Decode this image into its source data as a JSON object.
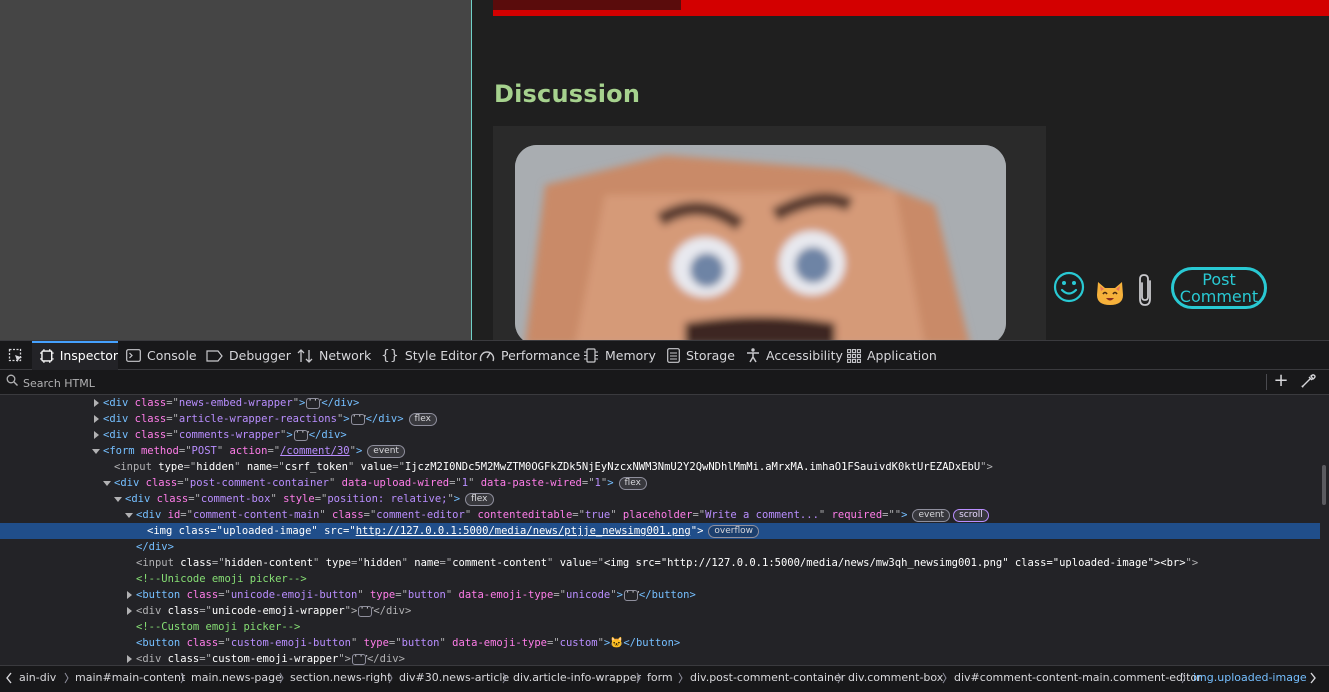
{
  "page": {
    "section_title": "Discussion",
    "post_button_label": "Post Comment"
  },
  "devtools": {
    "tabs": [
      {
        "label": "Inspector",
        "icon": "inspector-icon"
      },
      {
        "label": "Console",
        "icon": "console-icon"
      },
      {
        "label": "Debugger",
        "icon": "debugger-icon"
      },
      {
        "label": "Network",
        "icon": "network-icon"
      },
      {
        "label": "Style Editor",
        "icon": "style-editor-icon"
      },
      {
        "label": "Performance",
        "icon": "performance-icon"
      },
      {
        "label": "Memory",
        "icon": "memory-icon"
      },
      {
        "label": "Storage",
        "icon": "storage-icon"
      },
      {
        "label": "Accessibility",
        "icon": "accessibility-icon"
      },
      {
        "label": "Application",
        "icon": "application-icon"
      }
    ],
    "search_placeholder": "Search HTML",
    "markup": {
      "l0": {
        "tag": "div",
        "attr": "class",
        "val": "news-embed-wrapper"
      },
      "l1": {
        "tag": "div",
        "attr": "class",
        "val": "article-wrapper-reactions",
        "badge": "flex"
      },
      "l2": {
        "tag": "div",
        "attr": "class",
        "val": "comments-wrapper"
      },
      "l3": {
        "tag": "form",
        "a1": "method",
        "v1": "POST",
        "a2": "action",
        "v2": "/comment/30",
        "badge": "event"
      },
      "l4": {
        "tag": "input",
        "a1": "type",
        "v1": "hidden",
        "a2": "name",
        "v2": "csrf_token",
        "a3": "value",
        "v3": "IjczM2I0NDc5M2MwZTM0OGFkZDk5NjEyNzcxNWM3NmU2Y2QwNDhlMmMi.aMrxMA.imhaO1FSauivdK0ktUrEZADxEbU"
      },
      "l5": {
        "tag": "div",
        "a1": "class",
        "v1": "post-comment-container",
        "a2": "data-upload-wired",
        "v2": "1",
        "a3": "data-paste-wired",
        "v3": "1",
        "badge": "flex"
      },
      "l6": {
        "tag": "div",
        "a1": "class",
        "v1": "comment-box",
        "a2": "style",
        "v2": "position: relative;",
        "badge": "flex"
      },
      "l7": {
        "tag": "div",
        "a1": "id",
        "v1": "comment-content-main",
        "a2": "class",
        "v2": "comment-editor",
        "a3": "contenteditable",
        "v3": "true",
        "a4": "placeholder",
        "v4": "Write a comment...",
        "a5": "required",
        "v5": "",
        "badge1": "event",
        "badge2": "scroll"
      },
      "l8": {
        "tag": "img",
        "a1": "class",
        "v1": "uploaded-image",
        "a2": "src",
        "v2": "http://127.0.0.1:5000/media/news/ptjje_newsimg001.png",
        "badge": "overflow"
      },
      "l9": {
        "close": "</div>"
      },
      "l10": {
        "tag": "input",
        "a1": "class",
        "v1": "hidden-content",
        "a2": "type",
        "v2": "hidden",
        "a3": "name",
        "v3": "comment-content",
        "a4": "value",
        "v4": "<img src=\"http://127.0.0.1:5000/media/news/mw3qh_newsimg001.png\" class=\"uploaded-image\"><br>"
      },
      "l11": {
        "comment": "<!--Unicode emoji picker-->"
      },
      "l12": {
        "tag": "button",
        "a1": "class",
        "v1": "unicode-emoji-button",
        "a2": "type",
        "v2": "button",
        "a3": "data-emoji-type",
        "v3": "unicode"
      },
      "l13": {
        "tag": "div",
        "a1": "class",
        "v1": "unicode-emoji-wrapper"
      },
      "l14": {
        "comment": "<!--Custom emoji picker-->"
      },
      "l15": {
        "tag": "button",
        "a1": "class",
        "v1": "custom-emoji-button",
        "a2": "type",
        "v2": "button",
        "a3": "data-emoji-type",
        "v3": "custom",
        "content": "🐱"
      },
      "l16": {
        "tag": "div",
        "a1": "class",
        "v1": "custom-emoji-wrapper"
      }
    },
    "breadcrumbs": [
      "ain-div",
      "main#main-content",
      "main.news-page",
      "section.news-right",
      "div#30.news-article",
      "div.article-info-wrapper",
      "form",
      "div.post-comment-container",
      "div.comment-box",
      "div#comment-content-main.comment-editor",
      "img.uploaded-image"
    ]
  }
}
